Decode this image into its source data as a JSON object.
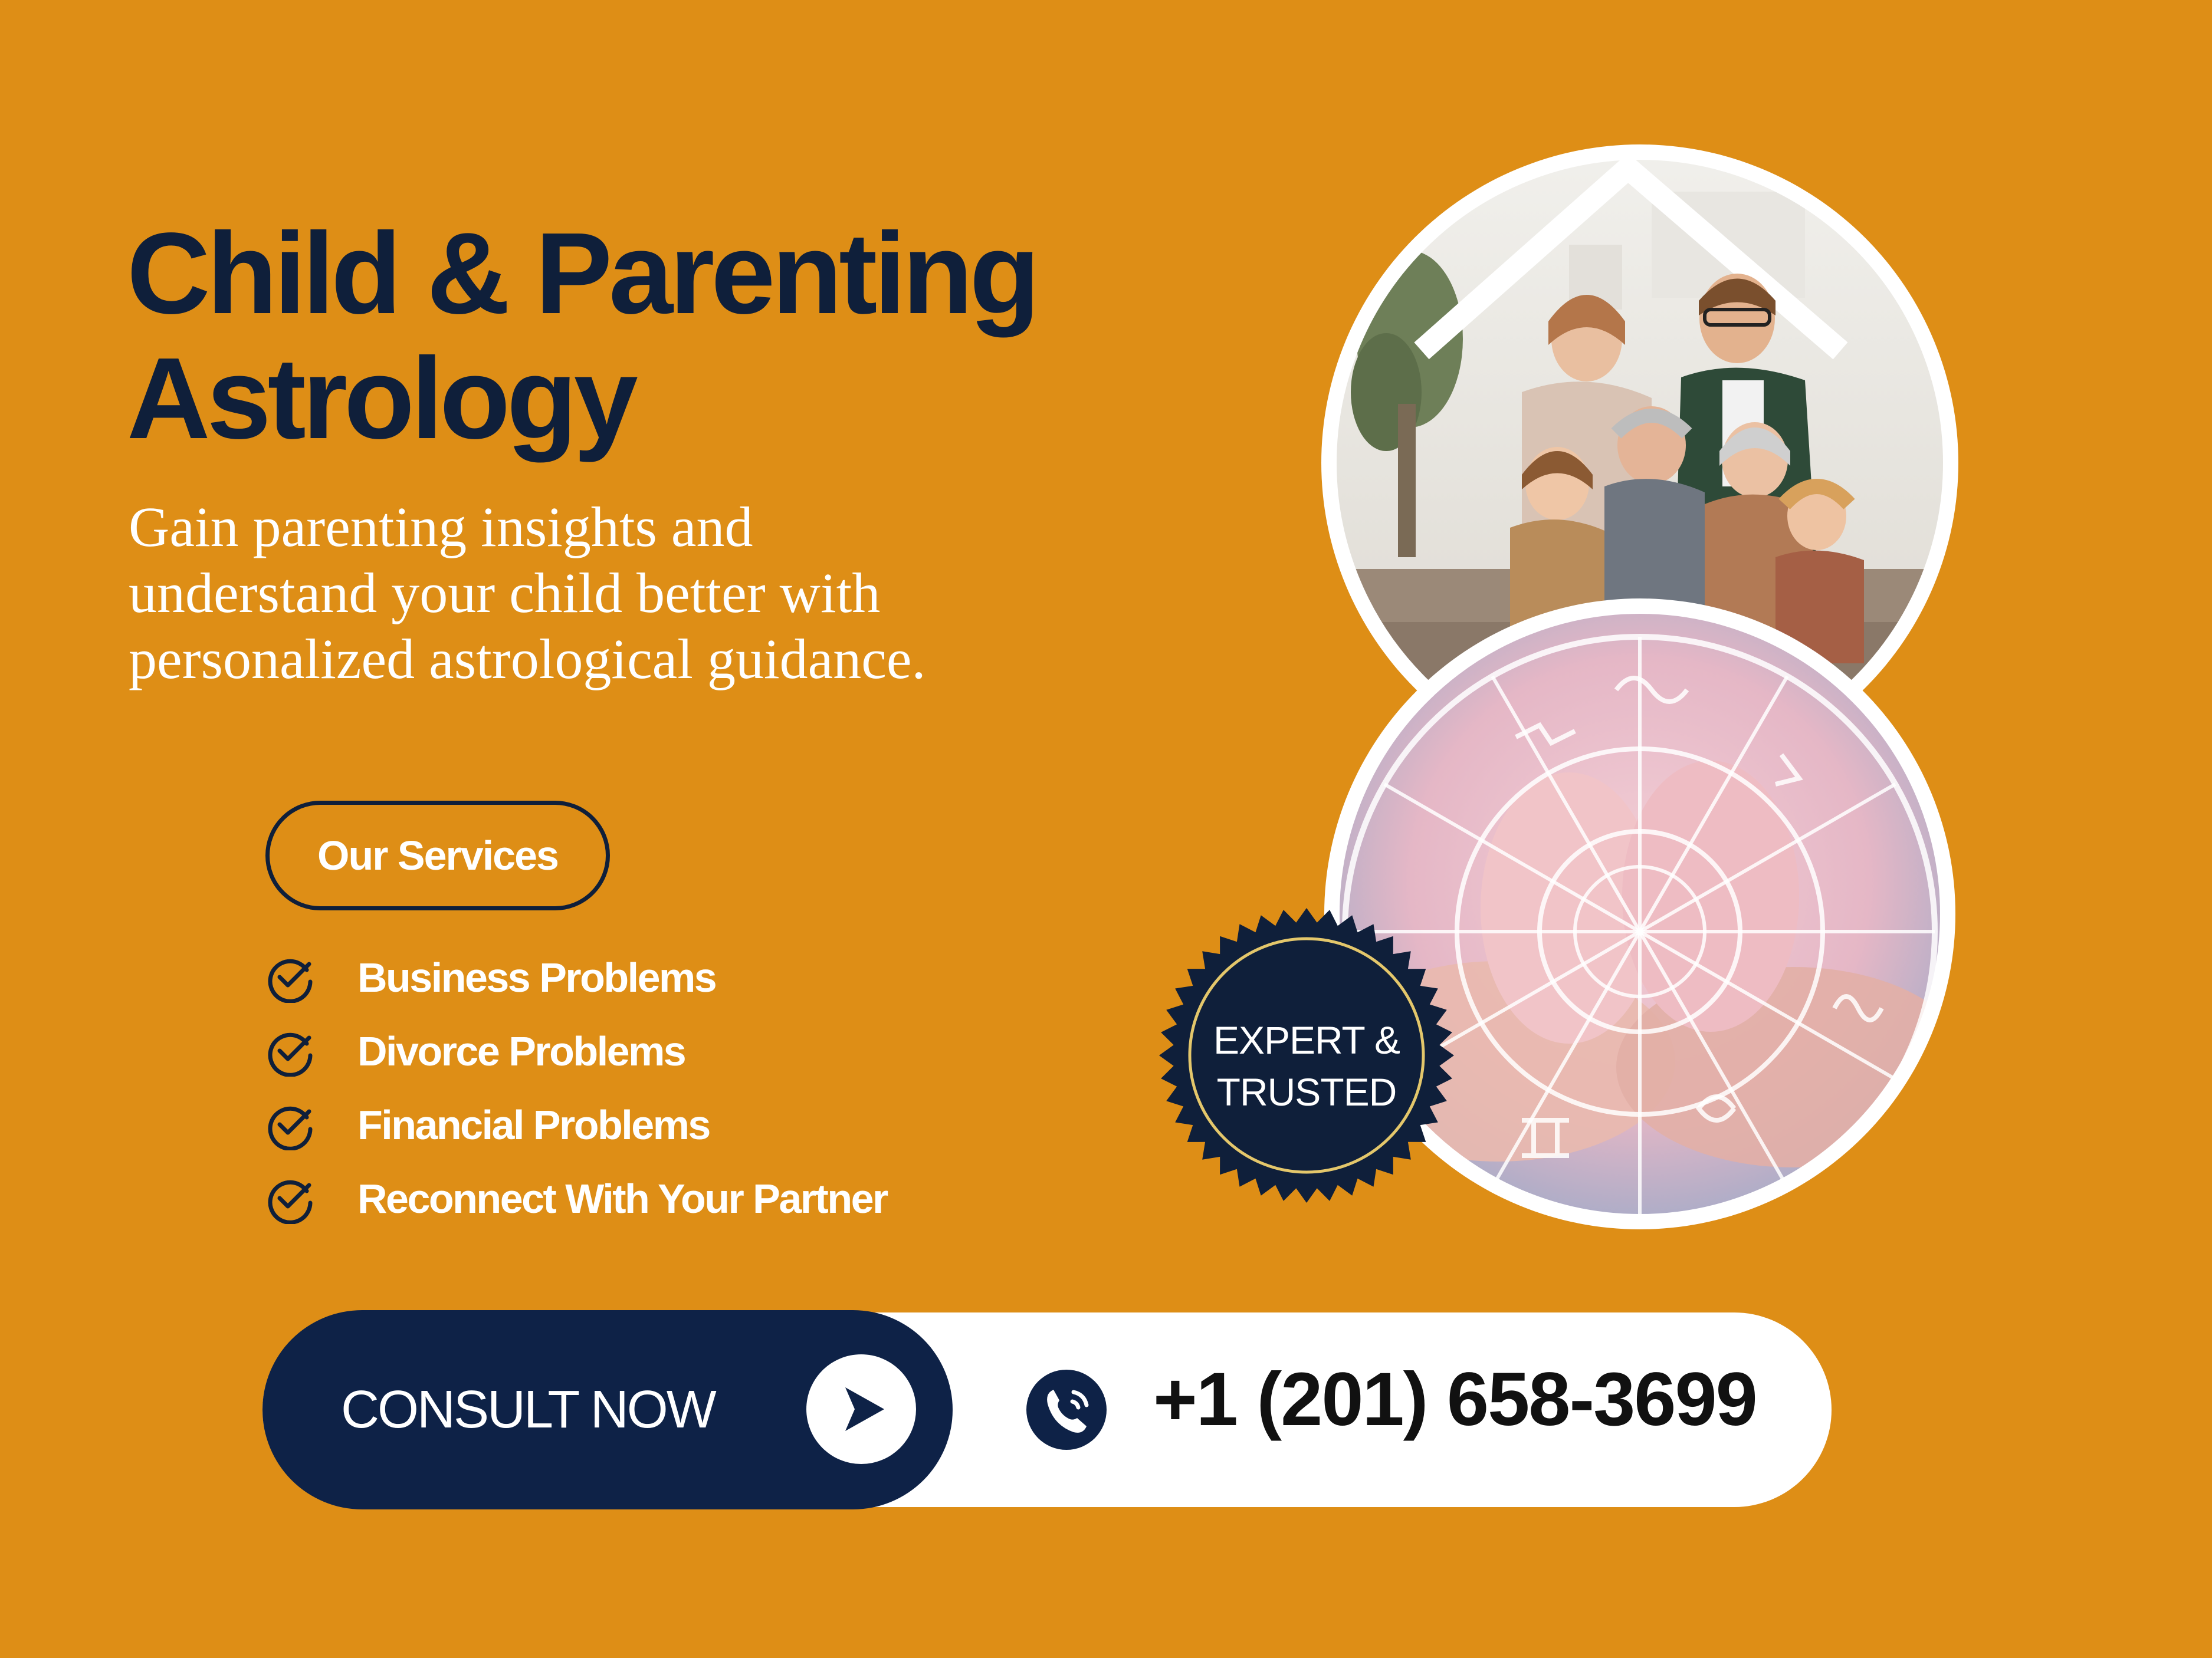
{
  "title_line1": "Child & Parenting",
  "title_line2": "Astrology",
  "subtitle_line1": "Gain parenting insights and",
  "subtitle_line2": "understand your child better with",
  "subtitle_line3": "personalized astrological guidance.",
  "services_heading": "Our Services",
  "services": [
    {
      "label": "Business Problems",
      "icon": "check-circle-icon"
    },
    {
      "label": "Divorce Problems",
      "icon": "check-circle-icon"
    },
    {
      "label": "Financial Problems",
      "icon": "check-circle-icon"
    },
    {
      "label": "Reconnect With Your Partner",
      "icon": "check-circle-icon"
    }
  ],
  "badge": {
    "line1": "EXPERT &",
    "line2": "TRUSTED"
  },
  "cta": {
    "consult_label": "CONSULT NOW",
    "play_icon": "play-arrow-icon",
    "phone_icon": "phone-icon",
    "phone_number": "+1 (201) 658-3699"
  },
  "images": {
    "top": "family-photo",
    "bottom": "baby-feet-zodiac-wheel-photo"
  },
  "colors": {
    "background": "#DE8E16",
    "navy": "#0E2247",
    "title": "#0F1F3A",
    "white": "#FFFFFF"
  }
}
